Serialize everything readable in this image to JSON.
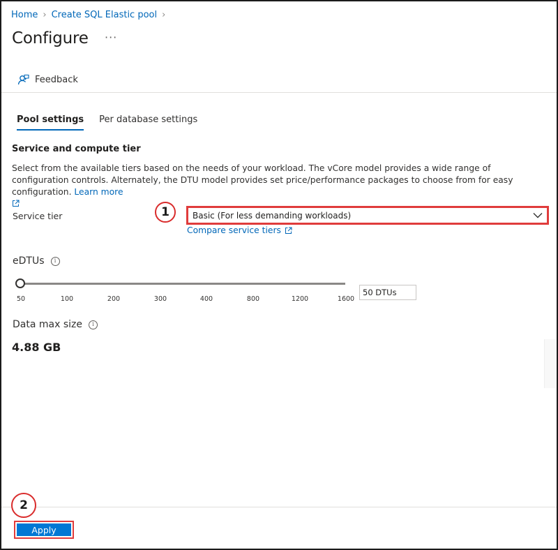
{
  "breadcrumb": {
    "home": "Home",
    "parent": "Create SQL Elastic pool",
    "separator": ">"
  },
  "page": {
    "title": "Configure",
    "more": "···"
  },
  "toolbar": {
    "feedback_label": "Feedback"
  },
  "tabs": [
    {
      "label": "Pool settings",
      "active": true
    },
    {
      "label": "Per database settings",
      "active": false
    }
  ],
  "section": {
    "heading": "Service and compute tier",
    "description": "Select from the available tiers based on the needs of your workload. The vCore model provides a wide range of configuration controls. Alternately, the DTU model provides set price/performance packages to choose from for easy configuration.",
    "learn_more": "Learn more"
  },
  "service_tier": {
    "label": "Service tier",
    "selected": "Basic (For less demanding workloads)",
    "compare_link": "Compare service tiers"
  },
  "edtus": {
    "label": "eDTUs",
    "ticks": [
      "50",
      "100",
      "200",
      "300",
      "400",
      "800",
      "1200",
      "1600"
    ],
    "value": "50 DTUs",
    "slider_fraction": 0
  },
  "data_max_size": {
    "label": "Data max size",
    "value": "4.88 GB"
  },
  "callouts": {
    "one": "1",
    "two": "2"
  },
  "footer": {
    "apply_label": "Apply"
  },
  "colors": {
    "accent": "#0078d4",
    "link": "#0067b8",
    "highlight": "#e03c3c"
  }
}
